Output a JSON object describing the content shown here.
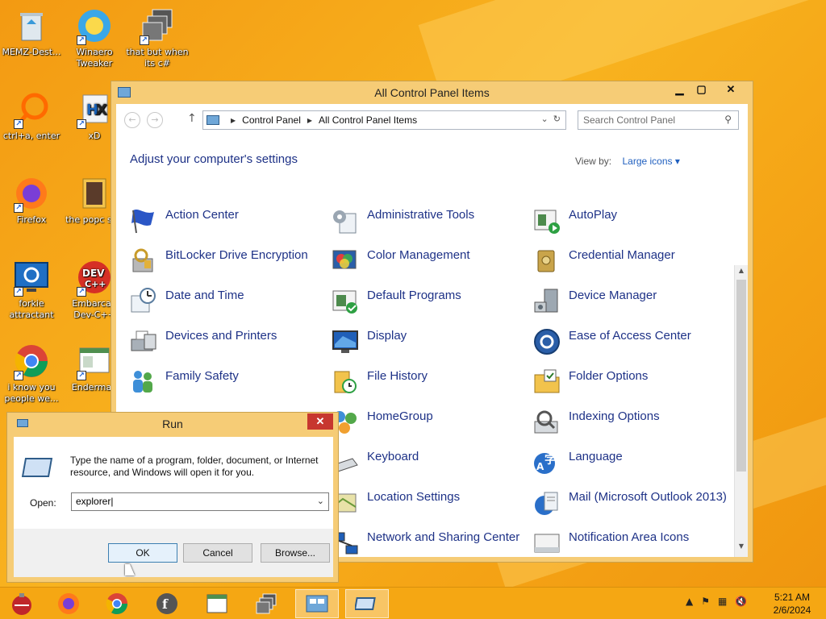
{
  "desktop": {
    "icons": [
      {
        "label": "MEMZ-Dest..."
      },
      {
        "label": "Winaero Tweaker"
      },
      {
        "label": "that but when its c#"
      },
      {
        "label": "ctrl+a, enter"
      },
      {
        "label": "xD"
      },
      {
        "label": "Firefox"
      },
      {
        "label": "the popc shit"
      },
      {
        "label": "forkie attractant"
      },
      {
        "label": "Embarcad Dev-C++"
      },
      {
        "label": "i know you people we..."
      },
      {
        "label": "Enderman"
      }
    ]
  },
  "control_panel": {
    "title": "All Control Panel Items",
    "breadcrumb": [
      "Control Panel",
      "All Control Panel Items"
    ],
    "search_placeholder": "Search Control Panel",
    "heading": "Adjust your computer's settings",
    "view_by_label": "View by:",
    "view_by_value": "Large icons",
    "items": [
      {
        "label": "Action Center",
        "icon": "flag-icon"
      },
      {
        "label": "Administrative Tools",
        "icon": "admin-tools-icon"
      },
      {
        "label": "AutoPlay",
        "icon": "autoplay-icon"
      },
      {
        "label": "BitLocker Drive Encryption",
        "icon": "bitlocker-icon"
      },
      {
        "label": "Color Management",
        "icon": "color-management-icon"
      },
      {
        "label": "Credential Manager",
        "icon": "credential-icon"
      },
      {
        "label": "Date and Time",
        "icon": "clock-icon"
      },
      {
        "label": "Default Programs",
        "icon": "default-programs-icon"
      },
      {
        "label": "Device Manager",
        "icon": "device-manager-icon"
      },
      {
        "label": "Devices and Printers",
        "icon": "printer-icon"
      },
      {
        "label": "Display",
        "icon": "display-icon"
      },
      {
        "label": "Ease of Access Center",
        "icon": "ease-of-access-icon"
      },
      {
        "label": "Family Safety",
        "icon": "family-safety-icon"
      },
      {
        "label": "File History",
        "icon": "file-history-icon"
      },
      {
        "label": "Folder Options",
        "icon": "folder-icon"
      },
      {
        "label": "HomeGroup",
        "icon": "homegroup-icon"
      },
      {
        "label": "Indexing Options",
        "icon": "indexing-icon"
      },
      {
        "label": "Keyboard",
        "icon": "keyboard-icon"
      },
      {
        "label": "Language",
        "icon": "language-icon"
      },
      {
        "label": "Location Settings",
        "icon": "location-icon"
      },
      {
        "label": "Mail (Microsoft Outlook 2013)",
        "icon": "mail-icon"
      },
      {
        "label": "Network and Sharing Center",
        "icon": "network-icon"
      },
      {
        "label": "Notification Area Icons",
        "icon": "notification-icon"
      }
    ]
  },
  "run_dialog": {
    "title": "Run",
    "message": "Type the name of a program, folder, document, or Internet resource, and Windows will open it for you.",
    "open_label": "Open:",
    "open_value": "explorer",
    "ok_label": "OK",
    "cancel_label": "Cancel",
    "browse_label": "Browse..."
  },
  "taskbar": {
    "time": "5:21 AM",
    "date": "2/6/2024"
  },
  "colors": {
    "desktop": "#f7a81c",
    "link_blue": "#1e3287",
    "window_frame": "#f6cc76"
  }
}
